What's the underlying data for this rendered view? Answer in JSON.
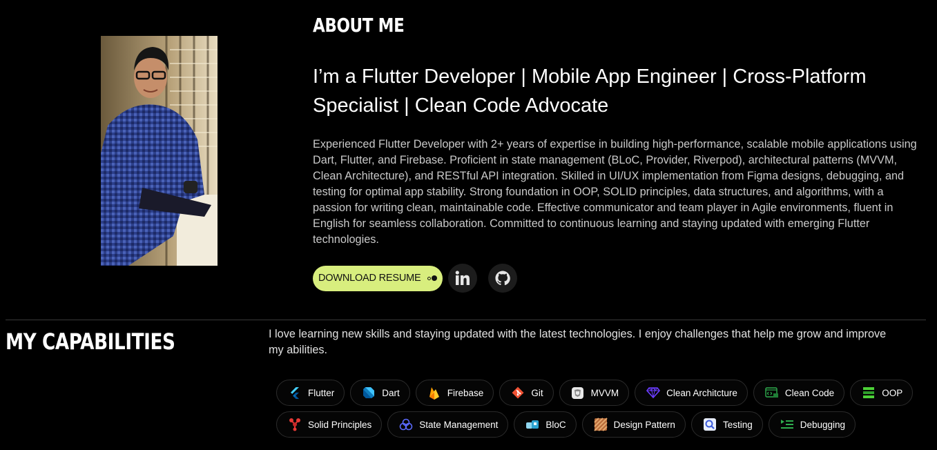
{
  "about": {
    "heading": "ABOUT ME",
    "tagline": "I’m a Flutter Developer | Mobile App Engineer | Cross-Platform Specialist | Clean Code Advocate",
    "bio": "Experienced Flutter Developer with 2+ years of expertise in building high-performance, scalable mobile applications using Dart, Flutter, and Firebase. Proficient in state management (BLoC, Provider, Riverpod), architectural patterns (MVVM, Clean Architecture), and RESTful API integration. Skilled in UI/UX implementation from Figma designs, debugging, and testing for optimal app stability. Strong foundation in OOP, SOLID principles, data structures, and algorithms, with a passion for writing clean, maintainable code. Effective communicator and team player in Agile environments, fluent in English for seamless collaboration. Committed to continuous learning and staying updated with emerging Flutter technologies.",
    "resume_label": "DOWNLOAD RESUME",
    "accent_color": "#d8ee7e"
  },
  "capabilities": {
    "heading": "MY CAPABILITIES",
    "description": "I love learning new skills and staying updated with the latest technologies. I enjoy challenges that help me grow and improve my abilities.",
    "skills": [
      {
        "label": "Flutter",
        "icon": "flutter-icon"
      },
      {
        "label": "Dart",
        "icon": "dart-icon"
      },
      {
        "label": "Firebase",
        "icon": "firebase-icon"
      },
      {
        "label": "Git",
        "icon": "git-icon"
      },
      {
        "label": "MVVM",
        "icon": "mvvm-icon"
      },
      {
        "label": "Clean Architcture",
        "icon": "diamond-icon"
      },
      {
        "label": "Clean Code",
        "icon": "code-icon"
      },
      {
        "label": "OOP",
        "icon": "oop-icon"
      },
      {
        "label": "Solid Principles",
        "icon": "molecule-icon"
      },
      {
        "label": "State Management",
        "icon": "state-icon"
      },
      {
        "label": "BloC",
        "icon": "bloc-icon"
      },
      {
        "label": "Design Pattern",
        "icon": "pattern-icon"
      },
      {
        "label": "Testing",
        "icon": "testing-icon"
      },
      {
        "label": "Debugging",
        "icon": "debugging-icon"
      }
    ]
  }
}
